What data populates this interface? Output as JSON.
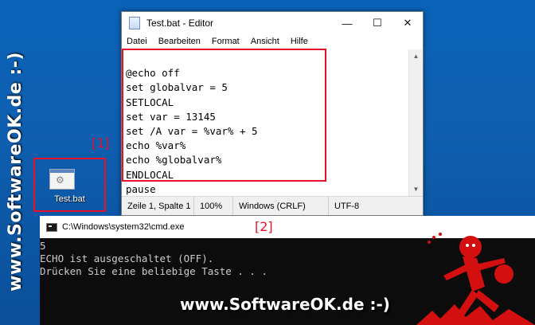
{
  "brand": {
    "side_text": "www.SoftwareOK.de :-)",
    "bottom_text": "www.SoftwareOK.de :-)"
  },
  "markers": {
    "one": "[1]",
    "two": "[2]"
  },
  "desktop_icon": {
    "label": "Test.bat",
    "icon": "batch-file-icon"
  },
  "editor": {
    "title": "Test.bat - Editor",
    "window_buttons": {
      "minimize": "—",
      "maximize": "☐",
      "close": "✕"
    },
    "menu": [
      "Datei",
      "Bearbeiten",
      "Format",
      "Ansicht",
      "Hilfe"
    ],
    "lines": [
      "@echo off",
      "set globalvar = 5",
      "SETLOCAL",
      "set var = 13145",
      "set /A var = %var% + 5",
      "echo %var%",
      "echo %globalvar%",
      "ENDLOCAL",
      "pause"
    ],
    "status": {
      "position": "Zeile 1, Spalte 1",
      "zoom": "100%",
      "line_endings": "Windows (CRLF)",
      "encoding": "UTF-8"
    }
  },
  "cmd": {
    "title": "C:\\Windows\\system32\\cmd.exe",
    "output": [
      "5",
      "ECHO ist ausgeschaltet (OFF).",
      "Drücken Sie eine beliebige Taste . . ."
    ]
  },
  "colors": {
    "highlight": "#e8102a",
    "desktop": "#0b63b8",
    "console_bg": "#0c0c0c",
    "console_text": "#cccccc"
  }
}
